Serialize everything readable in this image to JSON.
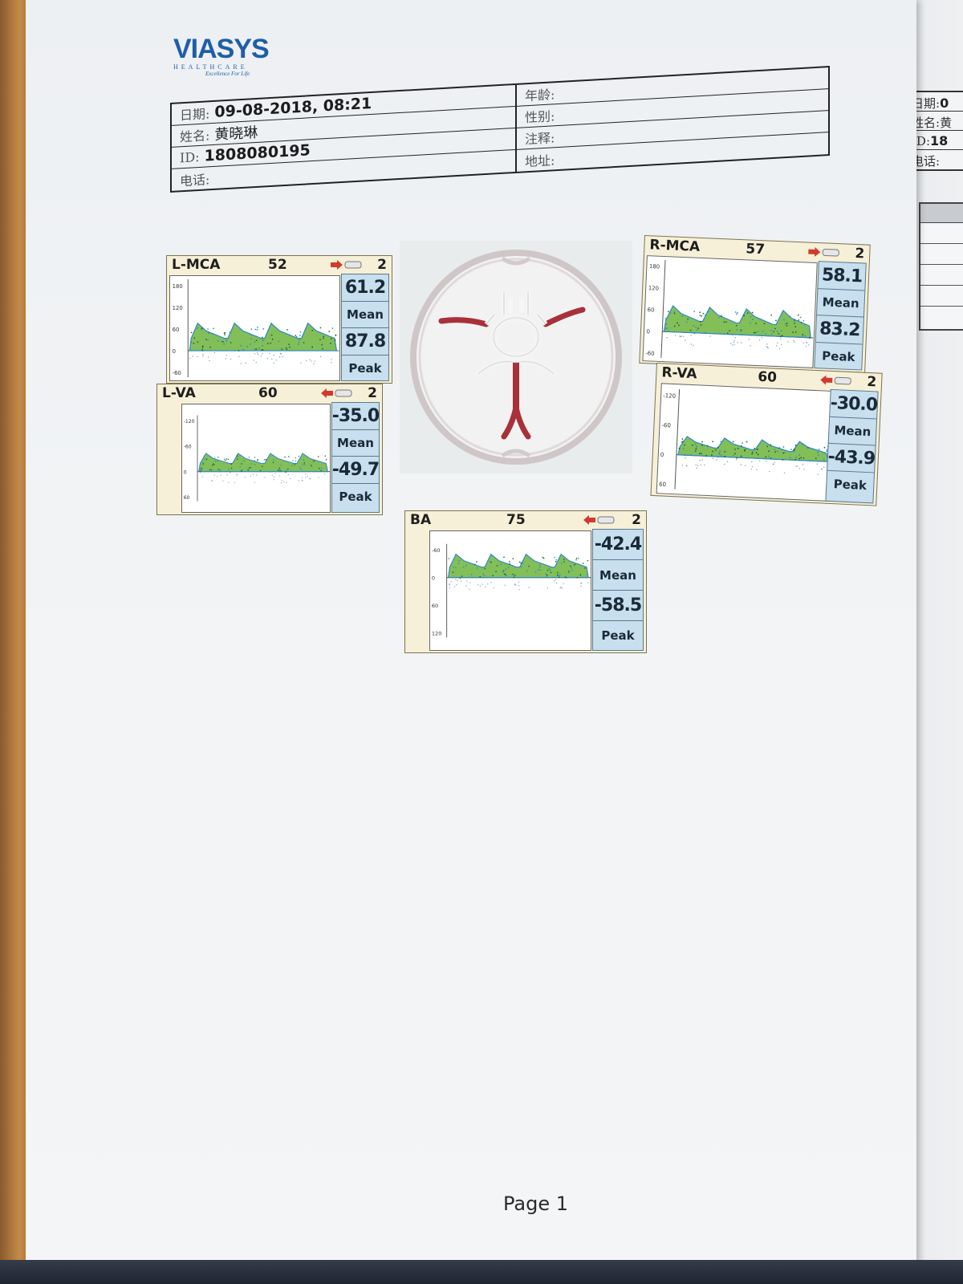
{
  "brand": {
    "name": "VIASYS",
    "sub": "HEALTHCARE",
    "tagline": "Excellence For Life"
  },
  "header": {
    "date_label": "日期:",
    "date_value": "09-08-2018, 08:21",
    "name_label": "姓名:",
    "name_value": "黄晓琳",
    "id_label": "ID:",
    "id_value": "1808080195",
    "phone_label": "电话:",
    "age_label": "年龄:",
    "sex_label": "性别:",
    "note_label": "注释:",
    "address_label": "地址:"
  },
  "panels": {
    "lmca": {
      "name": "L-MCA",
      "depth": "52",
      "gate": "2",
      "mean": "61.2",
      "mean_label": "Mean",
      "peak": "87.8",
      "peak_label": "Peak",
      "direction": "toward",
      "scale": [
        "180",
        "120",
        "60",
        "0",
        "-60"
      ]
    },
    "lva": {
      "name": "L-VA",
      "depth": "60",
      "gate": "2",
      "mean": "-35.0",
      "mean_label": "Mean",
      "peak": "-49.7",
      "peak_label": "Peak",
      "direction": "away",
      "scale": [
        "-120",
        "-60",
        "0",
        "60"
      ]
    },
    "rmca": {
      "name": "R-MCA",
      "depth": "57",
      "gate": "2",
      "mean": "58.1",
      "mean_label": "Mean",
      "peak": "83.2",
      "peak_label": "Peak",
      "direction": "toward",
      "scale": [
        "180",
        "120",
        "60",
        "0",
        "-60"
      ]
    },
    "rva": {
      "name": "R-VA",
      "depth": "60",
      "gate": "2",
      "mean": "-30.0",
      "mean_label": "Mean",
      "peak": "-43.9",
      "peak_label": "Peak",
      "direction": "away",
      "scale": [
        "-120",
        "-60",
        "0",
        "60"
      ]
    },
    "ba": {
      "name": "BA",
      "depth": "75",
      "gate": "2",
      "mean": "-42.4",
      "mean_label": "Mean",
      "peak": "-58.5",
      "peak_label": "Peak",
      "direction": "away",
      "scale": [
        "-60",
        "0",
        "60",
        "120"
      ]
    }
  },
  "next_page": {
    "date_label": "日期:",
    "date_value": "0",
    "name_label": "姓名:",
    "name_value": "黄",
    "id_label": "ID:",
    "id_value": "18",
    "phone_label": "电话:"
  },
  "footer": {
    "page_label": "Page 1"
  },
  "colors": {
    "brand_blue": "#1f5ea8",
    "panel_bg": "#f6f0d8",
    "readout_bg": "#c7dfee",
    "artery_red": "#a8303a",
    "flow_green": "#6cb43c",
    "flow_blue": "#2f86c4"
  }
}
